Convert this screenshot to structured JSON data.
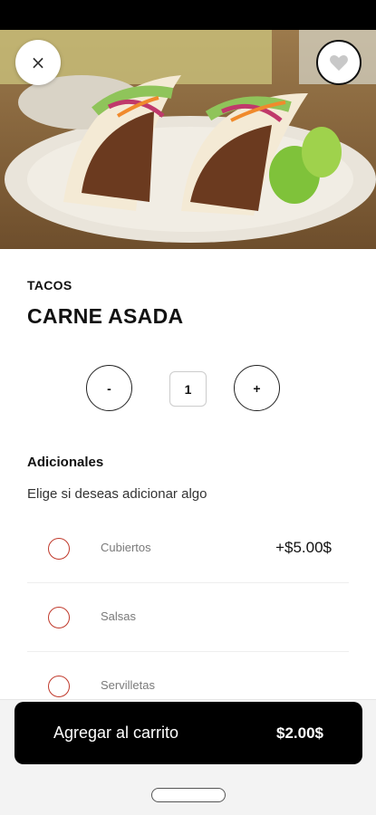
{
  "header": {
    "close_glyph": "×",
    "favorite_icon": "heart-icon"
  },
  "product": {
    "category": "TACOS",
    "name": "CARNE ASADA",
    "image": "tacos-photo"
  },
  "quantity": {
    "decrement_label": "-",
    "value": "1",
    "increment_label": "+"
  },
  "extras": {
    "title": "Adicionales",
    "subtitle": "Elige si deseas adicionar algo",
    "options": [
      {
        "label": "Cubiertos",
        "price": "+$5.00$"
      },
      {
        "label": "Salsas",
        "price": ""
      },
      {
        "label": "Servilletas",
        "price": ""
      }
    ]
  },
  "cart": {
    "button_label": "Agregar al carrito",
    "total": "$2.00$"
  },
  "colors": {
    "primary": "#000000",
    "radio_border": "#c0392b",
    "muted_text": "#7a7a7a"
  }
}
